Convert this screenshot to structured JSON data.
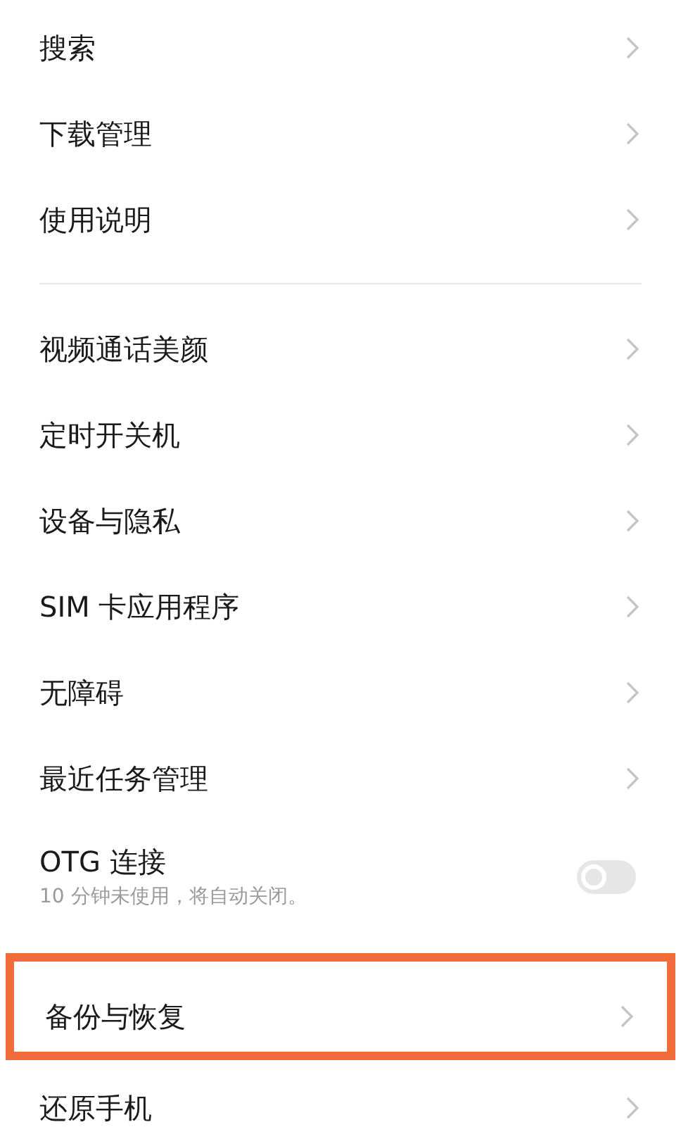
{
  "groups": [
    {
      "items": [
        {
          "kind": "link",
          "label": "搜索",
          "highlighted": false
        },
        {
          "kind": "link",
          "label": "下载管理",
          "highlighted": false
        },
        {
          "kind": "link",
          "label": "使用说明",
          "highlighted": false
        }
      ]
    },
    {
      "items": [
        {
          "kind": "link",
          "label": "视频通话美颜",
          "highlighted": false
        },
        {
          "kind": "link",
          "label": "定时开关机",
          "highlighted": false
        },
        {
          "kind": "link",
          "label": "设备与隐私",
          "highlighted": false
        },
        {
          "kind": "link",
          "label": "SIM 卡应用程序",
          "highlighted": false
        },
        {
          "kind": "link",
          "label": "无障碍",
          "highlighted": false
        },
        {
          "kind": "link",
          "label": "最近任务管理",
          "highlighted": false
        },
        {
          "kind": "toggle",
          "label": "OTG 连接",
          "subtitle": "10 分钟未使用，将自动关闭。",
          "on": false,
          "highlighted": false
        },
        {
          "kind": "link",
          "label": "备份与恢复",
          "highlighted": true
        },
        {
          "kind": "link",
          "label": "还原手机",
          "highlighted": false
        }
      ]
    }
  ]
}
